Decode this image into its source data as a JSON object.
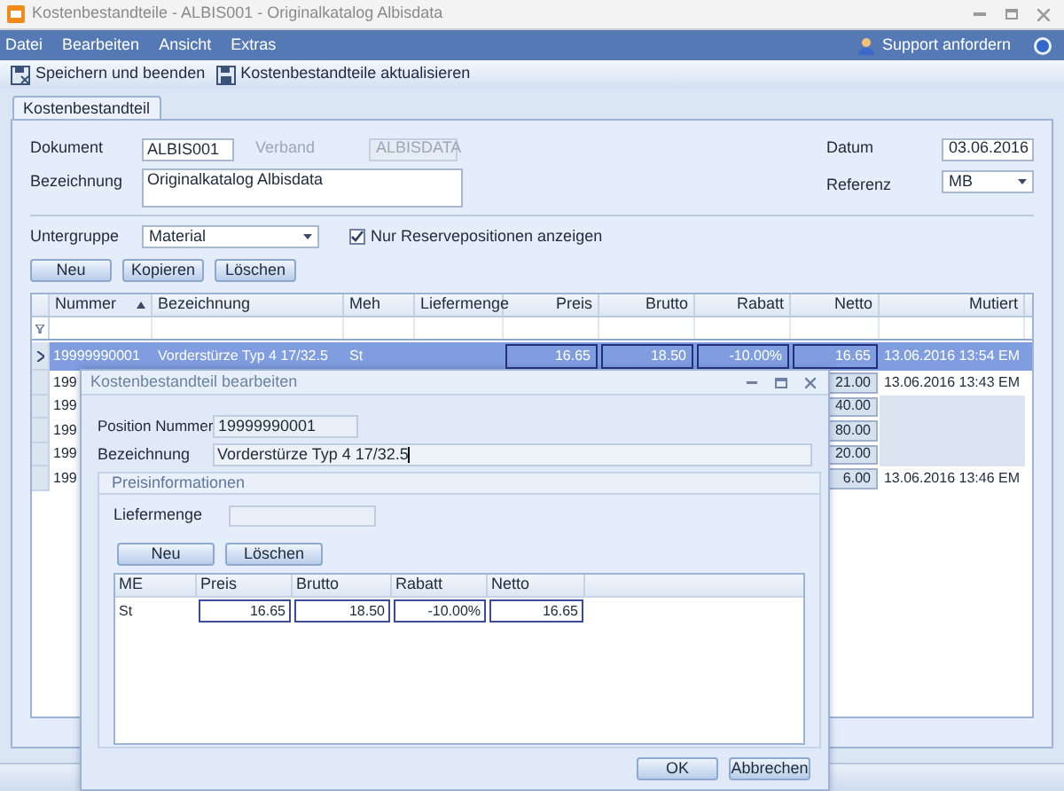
{
  "window": {
    "title": "Kostenbestandteile - ALBIS001 - Originalkatalog Albisdata"
  },
  "menu": {
    "items": [
      "Datei",
      "Bearbeiten",
      "Ansicht",
      "Extras"
    ],
    "support": "Support anfordern"
  },
  "toolbar": [
    {
      "label": "Speichern und beenden",
      "kind": "save-close"
    },
    {
      "label": "Kostenbestandteile aktualisieren",
      "kind": "save"
    }
  ],
  "tabs": [
    {
      "label": "Kostenbestandteil",
      "selected": true
    }
  ],
  "form": {
    "dokument": {
      "label": "Dokument",
      "value": "ALBIS001"
    },
    "verband": {
      "label": "Verband",
      "value": "ALBISDATA",
      "disabled": true
    },
    "datum": {
      "label": "Datum",
      "value": "03.06.2016"
    },
    "bezeichnung": {
      "label": "Bezeichnung",
      "value": "Originalkatalog Albisdata"
    },
    "referenz": {
      "label": "Referenz",
      "value": "MB"
    },
    "untergruppe": {
      "label": "Untergruppe",
      "value": "Material"
    },
    "reserve": {
      "label": "Nur Reservepositionen anzeigen",
      "checked": true
    }
  },
  "buttons": [
    "Neu",
    "Kopieren",
    "Löschen"
  ],
  "table": {
    "columns": [
      {
        "label": "Nummer",
        "sorted": true
      },
      {
        "label": "Bezeichnung",
        "sorted": false
      },
      {
        "label": "Meh",
        "sorted": false
      },
      {
        "label": "Liefermenge",
        "sorted": false
      },
      {
        "label": "Preis",
        "sorted": false
      },
      {
        "label": "Brutto",
        "sorted": false
      },
      {
        "label": "Rabatt",
        "sorted": false
      },
      {
        "label": "Netto",
        "sorted": false
      },
      {
        "label": "Mutiert",
        "sorted": false
      }
    ],
    "rows": [
      {
        "selected": true,
        "cells": [
          "19999990001",
          "Vorderstürze Typ 4 17/32.5",
          "St",
          null,
          "16.65",
          "18.50",
          "-10.00%",
          "16.65",
          "13.06.2016 13:54 EM"
        ]
      },
      {
        "selected": false,
        "cells": [
          "199",
          null,
          null,
          null,
          null,
          null,
          null,
          "21.00",
          "13.06.2016 13:43 EM"
        ]
      },
      {
        "selected": false,
        "cells": [
          "199",
          null,
          null,
          null,
          null,
          null,
          null,
          "40.00",
          null
        ]
      },
      {
        "selected": false,
        "cells": [
          "199",
          null,
          null,
          null,
          null,
          null,
          null,
          "80.00",
          null
        ]
      },
      {
        "selected": false,
        "cells": [
          "199",
          null,
          null,
          null,
          null,
          null,
          null,
          "20.00",
          null
        ]
      },
      {
        "selected": false,
        "cells": [
          "199",
          null,
          null,
          null,
          null,
          null,
          null,
          "6.00",
          "13.06.2016 13:46 EM"
        ]
      }
    ]
  },
  "dialog": {
    "title": "Kostenbestandteil bearbeiten",
    "position": {
      "label": "Position Nummer",
      "value": "19999990001"
    },
    "bezeichnung": {
      "label": "Bezeichnung",
      "value": "Vorderstürze Typ 4 17/32.5"
    },
    "group": "Preisinformationen",
    "liefermenge": {
      "label": "Liefermenge"
    },
    "buttons": [
      "Neu",
      "Löschen"
    ],
    "table": {
      "columns": [
        "ME",
        "Preis",
        "Brutto",
        "Rabatt",
        "Netto"
      ],
      "rows": [
        {
          "cells": [
            "St",
            "16.65",
            "18.50",
            "-10.00%",
            "16.65"
          ]
        }
      ]
    },
    "footer": [
      "OK",
      "Abbrechen"
    ]
  }
}
